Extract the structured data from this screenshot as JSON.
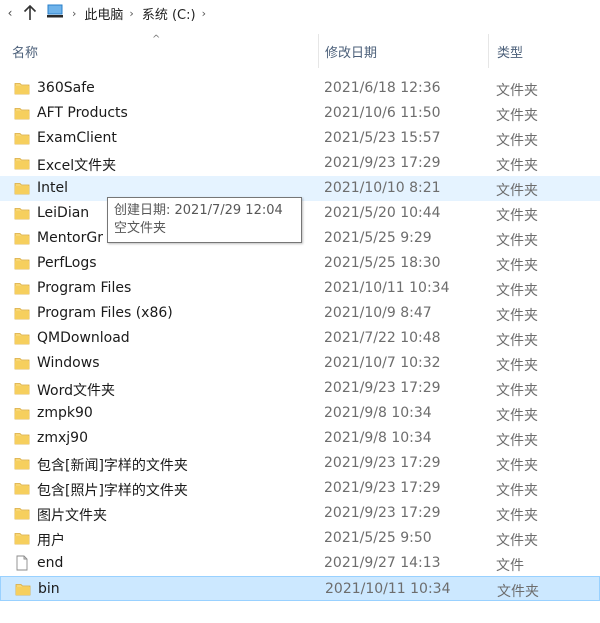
{
  "address": {
    "crumbs": [
      "此电脑",
      "系统 (C:)"
    ]
  },
  "columns": {
    "name": "名称",
    "date": "修改日期",
    "type": "类型"
  },
  "rows": [
    {
      "name": "360Safe",
      "date": "2021/6/18 12:36",
      "type": "文件夹",
      "kind": "folder"
    },
    {
      "name": "AFT Products",
      "date": "2021/10/6 11:50",
      "type": "文件夹",
      "kind": "folder"
    },
    {
      "name": "ExamClient",
      "date": "2021/5/23 15:57",
      "type": "文件夹",
      "kind": "folder"
    },
    {
      "name": "Excel文件夹",
      "date": "2021/9/23 17:29",
      "type": "文件夹",
      "kind": "folder"
    },
    {
      "name": "Intel",
      "date": "2021/10/10 8:21",
      "type": "文件夹",
      "kind": "folder",
      "state": "hover"
    },
    {
      "name": "LeiDian",
      "date": "2021/5/20 10:44",
      "type": "文件夹",
      "kind": "folder"
    },
    {
      "name": "MentorGr",
      "date": "2021/5/25 9:29",
      "type": "文件夹",
      "kind": "folder"
    },
    {
      "name": "PerfLogs",
      "date": "2021/5/25 18:30",
      "type": "文件夹",
      "kind": "folder"
    },
    {
      "name": "Program Files",
      "date": "2021/10/11 10:34",
      "type": "文件夹",
      "kind": "folder"
    },
    {
      "name": "Program Files (x86)",
      "date": "2021/10/9 8:47",
      "type": "文件夹",
      "kind": "folder"
    },
    {
      "name": "QMDownload",
      "date": "2021/7/22 10:48",
      "type": "文件夹",
      "kind": "folder"
    },
    {
      "name": "Windows",
      "date": "2021/10/7 10:32",
      "type": "文件夹",
      "kind": "folder"
    },
    {
      "name": "Word文件夹",
      "date": "2021/9/23 17:29",
      "type": "文件夹",
      "kind": "folder"
    },
    {
      "name": "zmpk90",
      "date": "2021/9/8 10:34",
      "type": "文件夹",
      "kind": "folder"
    },
    {
      "name": "zmxj90",
      "date": "2021/9/8 10:34",
      "type": "文件夹",
      "kind": "folder"
    },
    {
      "name": "包含[新闻]字样的文件夹",
      "date": "2021/9/23 17:29",
      "type": "文件夹",
      "kind": "folder"
    },
    {
      "name": "包含[照片]字样的文件夹",
      "date": "2021/9/23 17:29",
      "type": "文件夹",
      "kind": "folder"
    },
    {
      "name": "图片文件夹",
      "date": "2021/9/23 17:29",
      "type": "文件夹",
      "kind": "folder"
    },
    {
      "name": "用户",
      "date": "2021/5/25 9:50",
      "type": "文件夹",
      "kind": "folder"
    },
    {
      "name": "end",
      "date": "2021/9/27 14:13",
      "type": "文件",
      "kind": "file"
    },
    {
      "name": "bin",
      "date": "2021/10/11 10:34",
      "type": "文件夹",
      "kind": "folder",
      "state": "selected"
    }
  ],
  "tooltip": {
    "line1": "创建日期: 2021/7/29 12:04",
    "line2": "空文件夹"
  },
  "colors": {
    "folder": "#f8d775",
    "hover": "#e5f3ff",
    "selected": "#cce8ff",
    "header_text": "#4c607a"
  }
}
